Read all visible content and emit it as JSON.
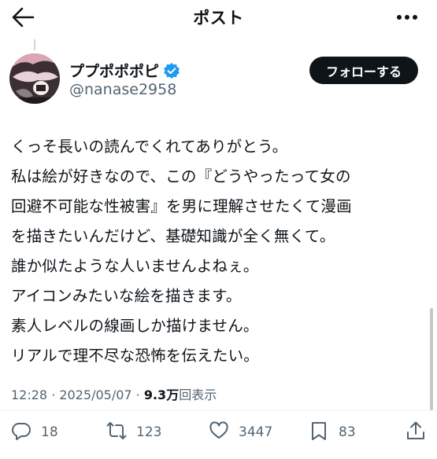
{
  "header": {
    "title": "ポスト"
  },
  "author": {
    "name": "ププポポポピ",
    "handle": "@nanase2958"
  },
  "follow_label": "フォローする",
  "post": {
    "lines": [
      "くっそ長いの読んでくれてありがとう。",
      "私は絵が好きなので、この『どうやったって女の",
      "回避不可能な性被害』を男に理解させたくて漫画",
      "を描きたいんだけど、基礎知識が全く無くて。",
      "誰か似たような人いませんよねぇ。",
      "アイコンみたいな絵を描きます。",
      "素人レベルの線画しか描けません。",
      "リアルで理不尽な恐怖を伝えたい。"
    ]
  },
  "meta": {
    "timestamp": "12:28 · 2025/05/07 · ",
    "views_count": "9.3万",
    "views_label": "回表示"
  },
  "actions": {
    "replies": "18",
    "reposts": "123",
    "likes": "3447",
    "bookmarks": "83"
  },
  "icons": [
    "back-arrow-icon",
    "more-dots-icon",
    "verified-badge-icon",
    "reply-icon",
    "repost-icon",
    "like-icon",
    "bookmark-icon",
    "share-icon"
  ],
  "colors": {
    "text": "#0f1419",
    "secondary": "#536471",
    "verified": "#1d9bf0",
    "button": "#0f1419"
  }
}
